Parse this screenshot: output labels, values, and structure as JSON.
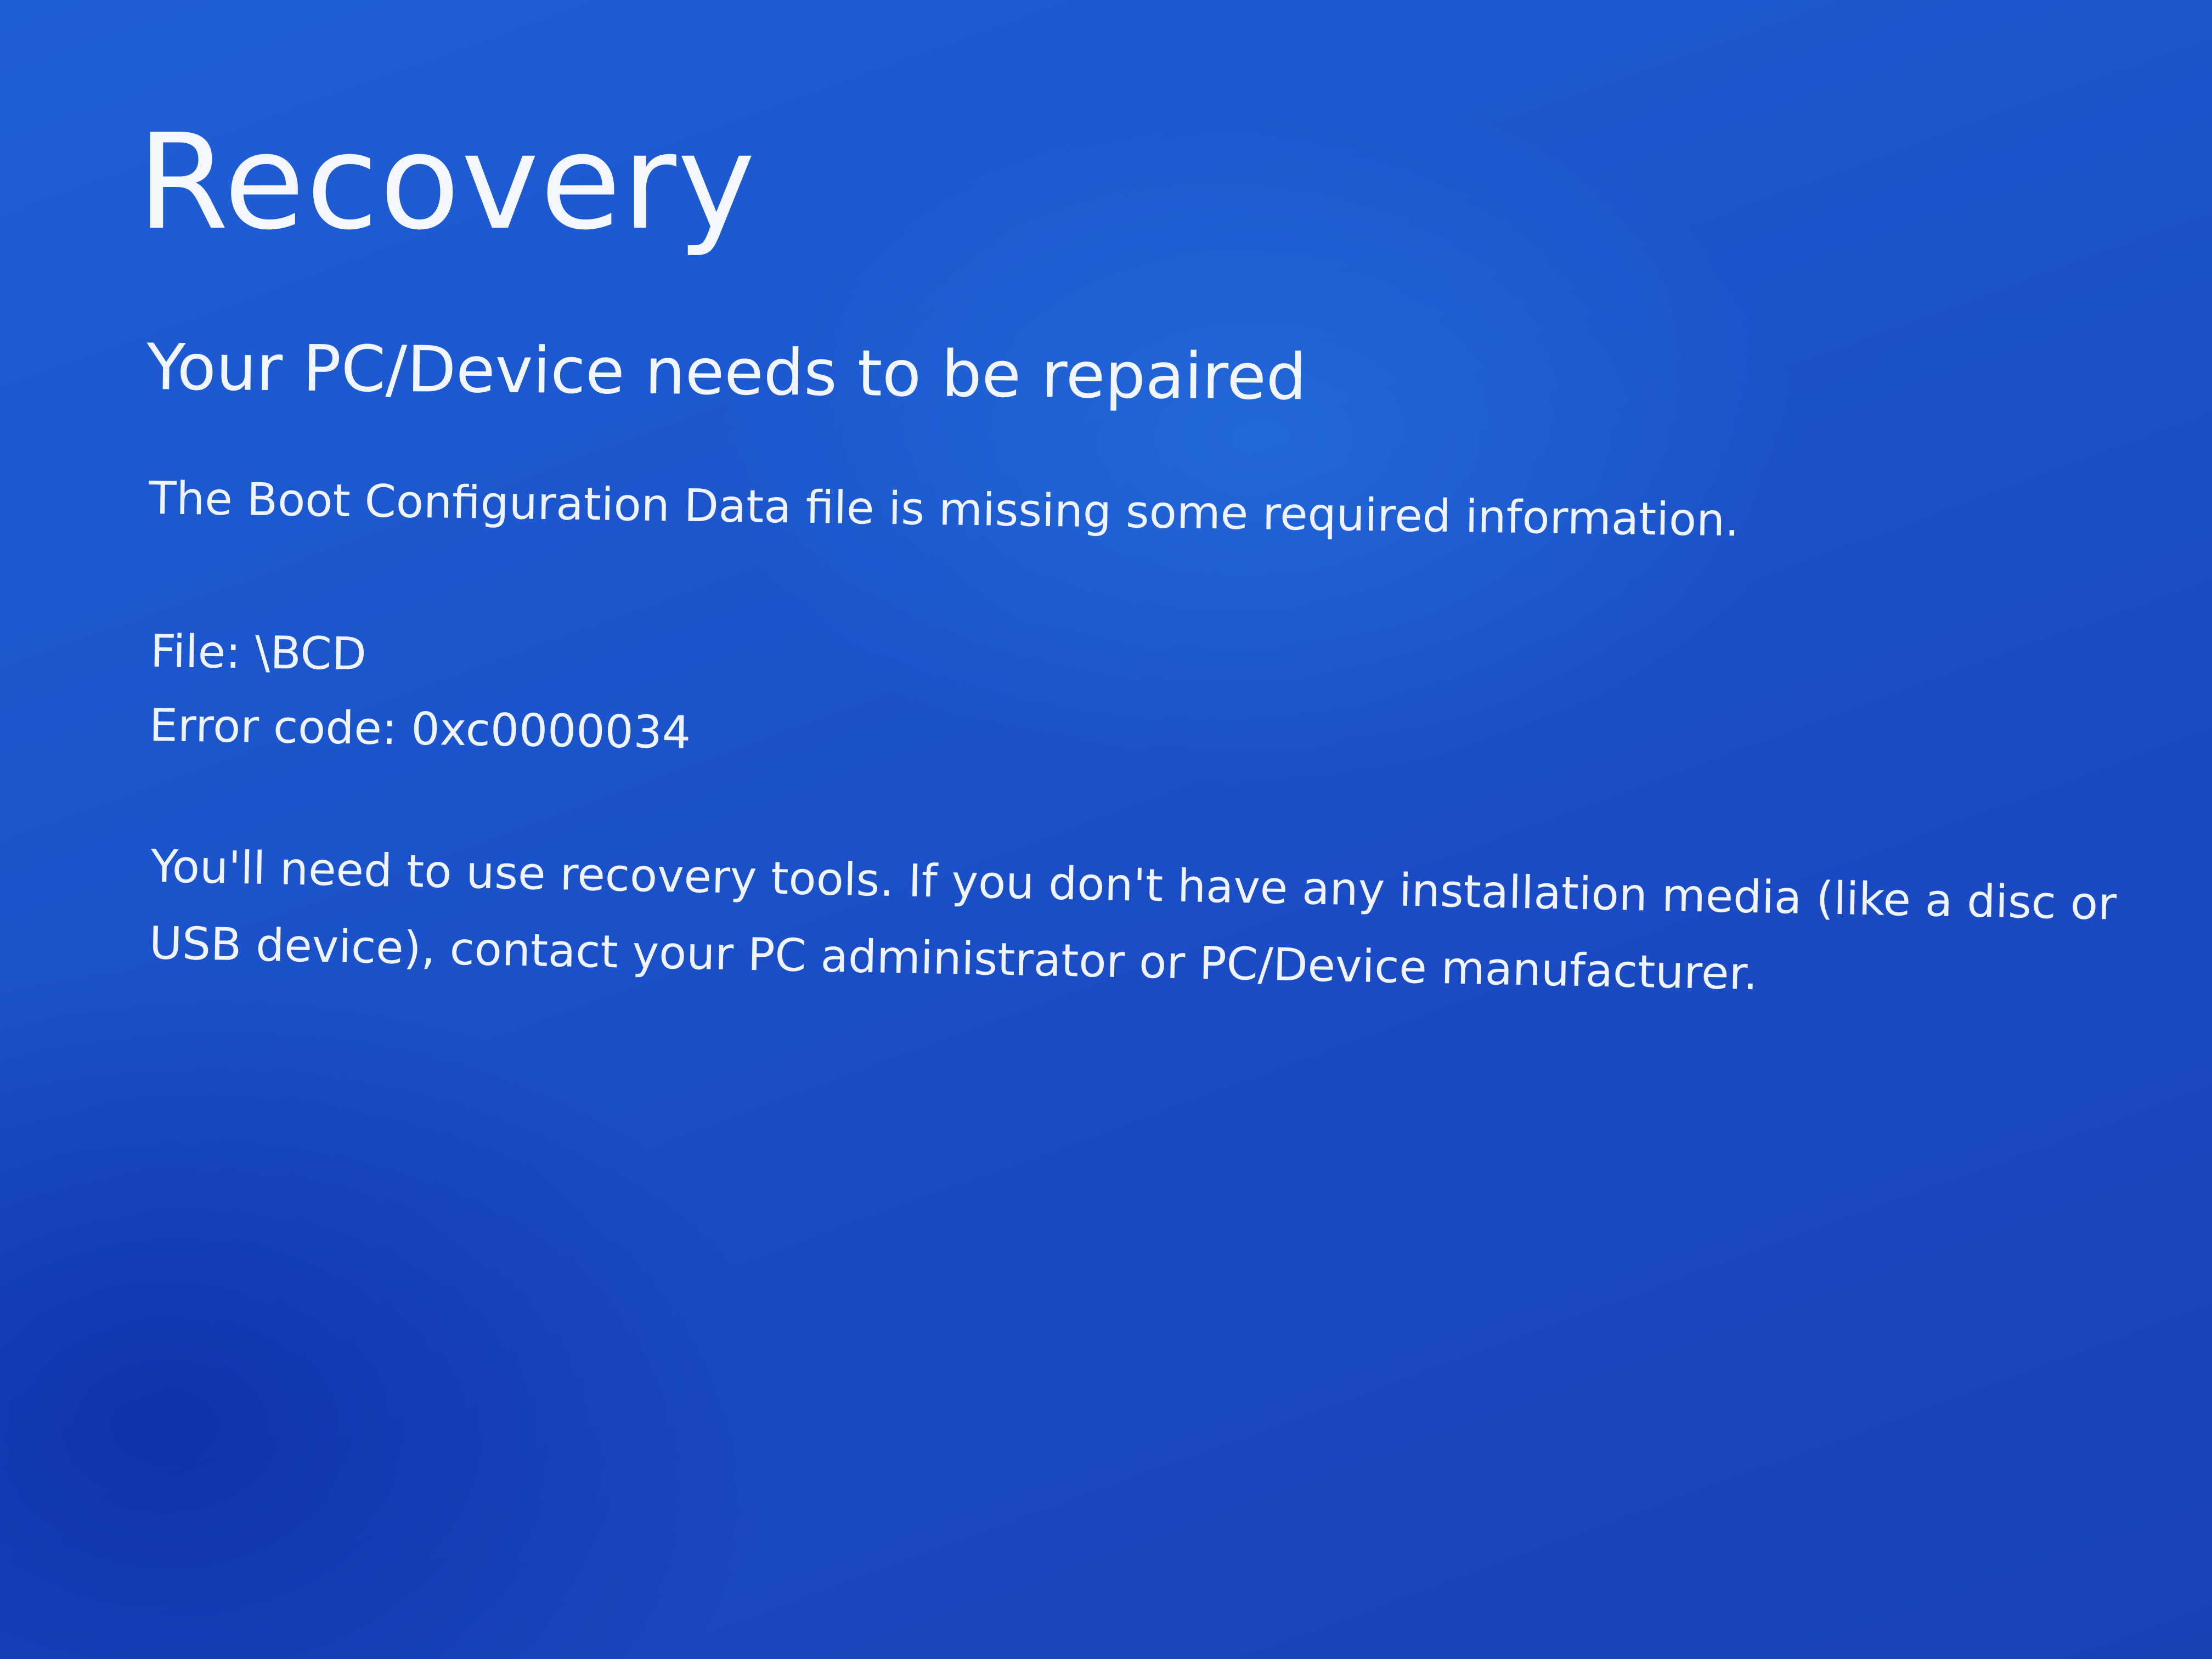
{
  "recovery": {
    "title": "Recovery",
    "subtitle": "Your PC/Device needs to be repaired",
    "message": "The Boot Configuration Data file is missing some required information.",
    "file_line": "File: \\BCD",
    "error_line": "Error code: 0xc0000034",
    "advice_lines": [
      "You'll need to use recovery tools. If you don't have any installation media (like a disc or",
      "USB device), contact your PC administrator or PC/Device manufacturer."
    ]
  },
  "colors": {
    "background": "#1b55cc",
    "text": "#eef3ff"
  }
}
